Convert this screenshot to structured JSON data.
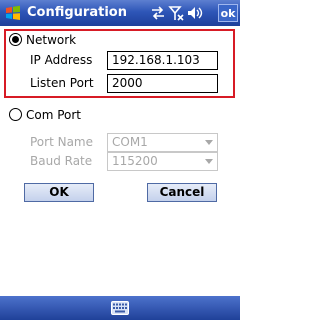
{
  "window": {
    "title": "Configuration",
    "ok_label": "ok",
    "status_icons": [
      "sync-icon",
      "signal-off-icon",
      "volume-icon"
    ]
  },
  "network": {
    "label": "Network",
    "selected": true,
    "ip_label": "IP Address",
    "ip_value": "192.168.1.103",
    "port_label": "Listen Port",
    "port_value": "2000"
  },
  "com": {
    "label": "Com Port",
    "selected": false,
    "port_name_label": "Port Name",
    "port_name_value": "COM1",
    "baud_label": "Baud Rate",
    "baud_value": "115200"
  },
  "buttons": {
    "ok": "OK",
    "cancel": "Cancel"
  },
  "softbar": {
    "icon": "keyboard-icon"
  },
  "colors": {
    "title_bar": "#2e56b8",
    "highlight_frame": "#d71b25",
    "disabled_text": "#a8a8a8"
  }
}
